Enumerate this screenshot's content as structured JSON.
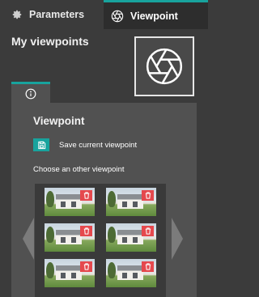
{
  "tabs": [
    {
      "label": "Parameters",
      "icon": "gear-icon",
      "active": false
    },
    {
      "label": "Viewpoint",
      "icon": "shutter-icon",
      "active": true
    }
  ],
  "title": "My viewpoints",
  "preview_icon": "shutter-icon",
  "info_tab_icon": "info-icon",
  "panel": {
    "subtitle": "Viewpoint",
    "save_label": "Save current viewpoint",
    "choose_label": "Choose an other viewpoint"
  },
  "viewpoints_count": 6,
  "colors": {
    "accent": "#18a39d",
    "delete": "#e5484d"
  }
}
